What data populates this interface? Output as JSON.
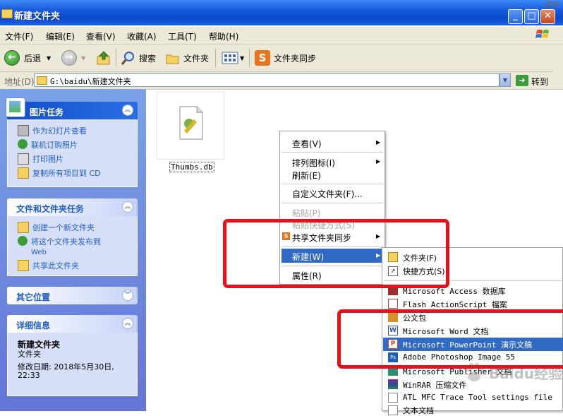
{
  "window": {
    "title": "新建文件夹",
    "corner_text": "菜单"
  },
  "menu": [
    "文件(F)",
    "编辑(E)",
    "查看(V)",
    "收藏(A)",
    "工具(T)",
    "帮助(H)"
  ],
  "toolbar": {
    "back": "后退",
    "search": "搜索",
    "folders": "文件夹",
    "sync": "文件夹同步"
  },
  "address": {
    "label": "地址(D)",
    "path": "G:\\baidu\\新建文件夹",
    "go": "转到"
  },
  "sidebar": {
    "picture_tasks": {
      "title": "图片任务",
      "items": [
        "作为幻灯片查看",
        "联机订购照片",
        "打印图片",
        "复制所有项目到 CD"
      ]
    },
    "file_tasks": {
      "title": "文件和文件夹任务",
      "items": [
        "创建一个新文件夹",
        "将这个文件夹发布到",
        "Web",
        "共享此文件夹"
      ]
    },
    "other_places": {
      "title": "其它位置"
    },
    "details": {
      "title": "详细信息",
      "name": "新建文件夹",
      "type": "文件夹",
      "modified": "修改日期: 2018年5月30日,",
      "time": "22:33"
    }
  },
  "file": {
    "name": "Thumbs.db"
  },
  "context_menu": {
    "view": "查看(V)",
    "arrange": "排列图标(I)",
    "refresh": "刷新(E)",
    "customize": "自定义文件夹(F)...",
    "paste": "粘贴(P)",
    "paste_shortcut": "粘贴快捷方式(S)",
    "share_sync": "共享文件夹同步",
    "new": "新建(W)",
    "properties": "属性(R)"
  },
  "new_submenu": [
    "文件夹(F)",
    "快捷方式(S)",
    "Microsoft Access 数据库",
    "Flash ActionScript 檔案",
    "公文包",
    "Microsoft Word 文档",
    "Microsoft PowerPoint 演示文稿",
    "Adobe Photoshop Image 55",
    "Microsoft Publisher 文档",
    "WinRAR 压缩文件",
    "ATL MFC Trace Tool settings file",
    "文本文档"
  ],
  "watermark": "Baidu经验",
  "colors": {
    "highlight": "#316ac5",
    "annotation": "#e8111a",
    "sidebar_link": "#215dc6"
  }
}
